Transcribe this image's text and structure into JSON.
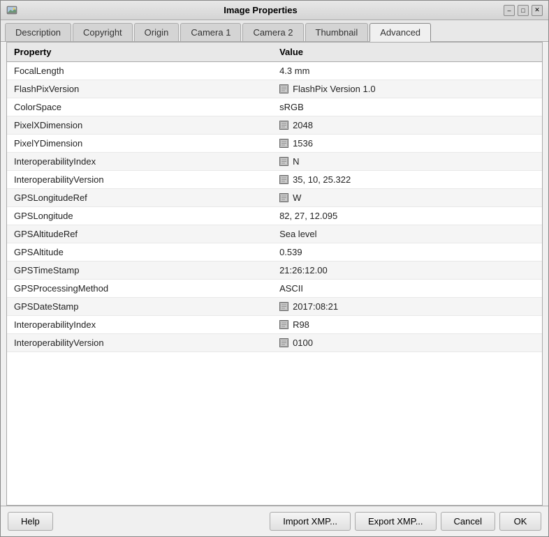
{
  "window": {
    "title": "Image Properties",
    "icon": "image-icon"
  },
  "titlebar_controls": {
    "minimize": "–",
    "maximize": "□",
    "close": "✕"
  },
  "tabs": [
    {
      "id": "description",
      "label": "Description",
      "active": false
    },
    {
      "id": "copyright",
      "label": "Copyright",
      "active": false
    },
    {
      "id": "origin",
      "label": "Origin",
      "active": false
    },
    {
      "id": "camera1",
      "label": "Camera 1",
      "active": false
    },
    {
      "id": "camera2",
      "label": "Camera 2",
      "active": false
    },
    {
      "id": "thumbnail",
      "label": "Thumbnail",
      "active": false
    },
    {
      "id": "advanced",
      "label": "Advanced",
      "active": true
    }
  ],
  "table": {
    "headers": {
      "property": "Property",
      "value": "Value"
    },
    "rows": [
      {
        "property": "FocalLength",
        "value": "4.3 mm",
        "has_icon": false
      },
      {
        "property": "FlashPixVersion",
        "value": "FlashPix Version 1.0",
        "has_icon": true
      },
      {
        "property": "ColorSpace",
        "value": "sRGB",
        "has_icon": false
      },
      {
        "property": "PixelXDimension",
        "value": "2048",
        "has_icon": true
      },
      {
        "property": "PixelYDimension",
        "value": "1536",
        "has_icon": true
      },
      {
        "property": "InteroperabilityIndex",
        "value": "N",
        "has_icon": true
      },
      {
        "property": "InteroperabilityVersion",
        "value": "35, 10, 25.322",
        "has_icon": true
      },
      {
        "property": "GPSLongitudeRef",
        "value": "W",
        "has_icon": true
      },
      {
        "property": "GPSLongitude",
        "value": "82, 27, 12.095",
        "has_icon": false
      },
      {
        "property": "GPSAltitudeRef",
        "value": "Sea level",
        "has_icon": false
      },
      {
        "property": "GPSAltitude",
        "value": "0.539",
        "has_icon": false
      },
      {
        "property": "GPSTimeStamp",
        "value": "21:26:12.00",
        "has_icon": false
      },
      {
        "property": "GPSProcessingMethod",
        "value": "ASCII",
        "has_icon": false
      },
      {
        "property": "GPSDateStamp",
        "value": "2017:08:21",
        "has_icon": true
      },
      {
        "property": "InteroperabilityIndex",
        "value": "R98",
        "has_icon": true
      },
      {
        "property": "InteroperabilityVersion",
        "value": "0100",
        "has_icon": true
      }
    ]
  },
  "buttons": {
    "help": "Help",
    "import_xmp": "Import XMP...",
    "export_xmp": "Export XMP...",
    "cancel": "Cancel",
    "ok": "OK"
  }
}
